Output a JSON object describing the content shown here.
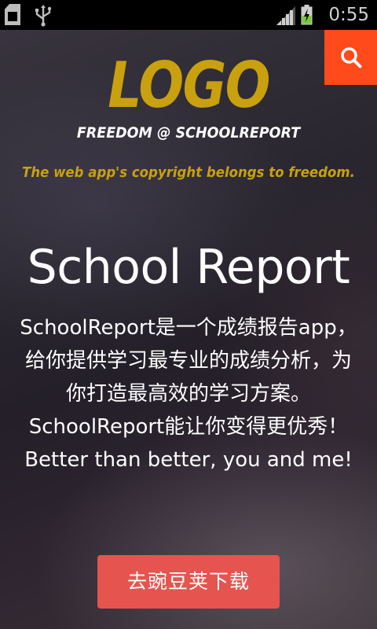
{
  "status_bar": {
    "time": "0:55",
    "icons": [
      "sd-card-icon",
      "usb-icon",
      "signal-icon",
      "battery-charging-icon"
    ]
  },
  "header": {
    "search_icon": "search-icon",
    "search_bg_color": "#ff4a1c"
  },
  "logo": {
    "text": "LOGO",
    "subtitle": "FREEDOM @ SCHOOLREPORT",
    "copyright": "The web app's copyright belongs to freedom.",
    "color": "#c9a00e"
  },
  "main": {
    "title": "School Report",
    "description": "SchoolReport是一个成绩报告app，给你提供学习最专业的成绩分析，为你打造最高效的学习方案。SchoolReport能让你变得更优秀！Better than better, you and me!"
  },
  "cta": {
    "download_label": "去豌豆荚下载",
    "color": "#e5544f"
  }
}
